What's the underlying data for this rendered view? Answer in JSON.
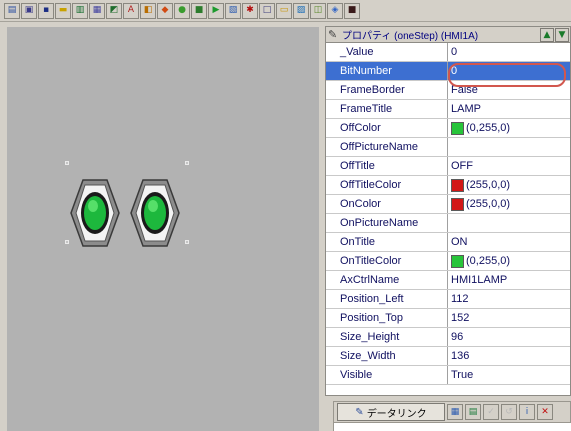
{
  "toolbar": {
    "buttons": [
      {
        "name": "screen-icon",
        "glyph": "▤",
        "color": "#2a4ea0"
      },
      {
        "name": "window-icon",
        "glyph": "▣",
        "color": "#3a3a8a"
      },
      {
        "name": "save-icon",
        "glyph": "▪",
        "color": "#1b2d84"
      },
      {
        "name": "folder-icon",
        "glyph": "▬",
        "color": "#c8a200"
      },
      {
        "name": "chart-icon",
        "glyph": "▥",
        "color": "#0f6a2a"
      },
      {
        "name": "grid-icon",
        "glyph": "▦",
        "color": "#3f3f9f"
      },
      {
        "name": "select-icon",
        "glyph": "◩",
        "color": "#1f6d2d"
      },
      {
        "name": "text-tool-icon",
        "glyph": "A",
        "color": "#b02020"
      },
      {
        "name": "image-icon",
        "glyph": "◧",
        "color": "#b86d00"
      },
      {
        "name": "palette-icon",
        "glyph": "◆",
        "color": "#d14a12"
      },
      {
        "name": "lamp-tool-icon",
        "glyph": "●",
        "color": "#3a9c2e"
      },
      {
        "name": "switch-tool-icon",
        "glyph": "■",
        "color": "#2d7c2d"
      },
      {
        "name": "play-icon",
        "glyph": "▶",
        "color": "#1c9a2d"
      },
      {
        "name": "link-icon",
        "glyph": "▧",
        "color": "#2b5bb0"
      },
      {
        "name": "gear-icon",
        "glyph": "✱",
        "color": "#b20d0d"
      },
      {
        "name": "frame-icon",
        "glyph": "□",
        "color": "#3d3d7d"
      },
      {
        "name": "layer-icon",
        "glyph": "▭",
        "color": "#c89400"
      },
      {
        "name": "view-icon",
        "glyph": "▨",
        "color": "#1a6db8"
      },
      {
        "name": "image-tool-icon",
        "glyph": "◫",
        "color": "#5a8a2a"
      },
      {
        "name": "paint-icon",
        "glyph": "◈",
        "color": "#2f63c6"
      },
      {
        "name": "dark-icon",
        "glyph": "■",
        "color": "#3a1a1a"
      }
    ]
  },
  "canvas": {
    "background": "#b2b2b2",
    "lamps": [
      {
        "name": "lamp-1",
        "color": "#1db83d"
      },
      {
        "name": "lamp-2",
        "color": "#1db83d"
      }
    ]
  },
  "properties": {
    "header": "プロパティ (oneStep) (HMI1A)",
    "rows": [
      {
        "name": "_Value",
        "value": "0"
      },
      {
        "name": "BitNumber",
        "value": "0",
        "selected": true
      },
      {
        "name": "FrameBorder",
        "value": "False"
      },
      {
        "name": "FrameTitle",
        "value": "LAMP"
      },
      {
        "name": "OffColor",
        "value": "(0,255,0)",
        "swatch": "#27c43a"
      },
      {
        "name": "OffPictureName",
        "value": ""
      },
      {
        "name": "OffTitle",
        "value": "OFF"
      },
      {
        "name": "OffTitleColor",
        "value": "(255,0,0)",
        "swatch": "#d21616"
      },
      {
        "name": "OnColor",
        "value": "(255,0,0)",
        "swatch": "#d21616"
      },
      {
        "name": "OnPictureName",
        "value": ""
      },
      {
        "name": "OnTitle",
        "value": "ON"
      },
      {
        "name": "OnTitleColor",
        "value": "(0,255,0)",
        "swatch": "#27c43a"
      },
      {
        "name": "AxCtrlName",
        "value": "HMI1LAMP"
      },
      {
        "name": "Position_Left",
        "value": "112"
      },
      {
        "name": "Position_Top",
        "value": "152"
      },
      {
        "name": "Size_Height",
        "value": "96"
      },
      {
        "name": "Size_Width",
        "value": "136"
      },
      {
        "name": "Visible",
        "value": "True"
      }
    ]
  },
  "datalink": {
    "label": "データリンク"
  },
  "colors": {
    "selection": "#3d6fd1",
    "highlight_ring": "#d2574e",
    "lamp_green": "#1db83d"
  }
}
